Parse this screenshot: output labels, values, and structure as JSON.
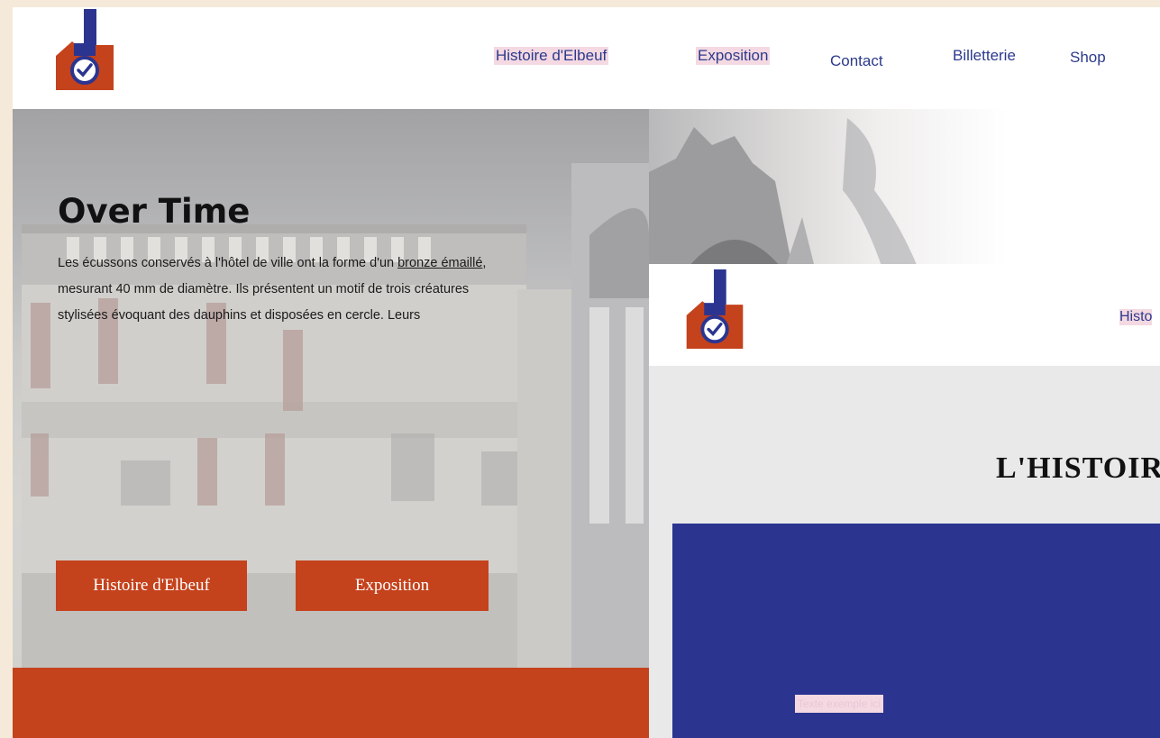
{
  "nav": {
    "items": [
      {
        "label": "Histoire d'Elbeuf",
        "highlighted": true
      },
      {
        "label": "Exposition",
        "highlighted": true
      },
      {
        "label": "Contact",
        "highlighted": false
      },
      {
        "label": "Billetterie",
        "highlighted": false
      },
      {
        "label": "Shop",
        "highlighted": false
      }
    ]
  },
  "hero": {
    "title": "Over Time",
    "text_before_link": "Les écussons conservés à l'hôtel de ville ont la forme d'un ",
    "link_text": "bronze émaillé",
    "text_after_link": ", mesurant 40 mm de diamètre. Ils présentent un motif de trois créatures stylisées évoquant des dauphins et disposées en cercle. Leurs",
    "buttons": {
      "histoire": "Histoire d'Elbeuf",
      "exposition": "Exposition"
    }
  },
  "second_page": {
    "nav_item": "Histo",
    "title": "L'HISTOIR",
    "panel_label": "Texte exemple ici"
  },
  "colors": {
    "brand_blue": "#2b3590",
    "brand_orange": "#c4421c",
    "nav_highlight": "#f4d9e2",
    "page_background": "#f5ead9"
  },
  "icons": {
    "logo": "factory-clock-logo"
  }
}
